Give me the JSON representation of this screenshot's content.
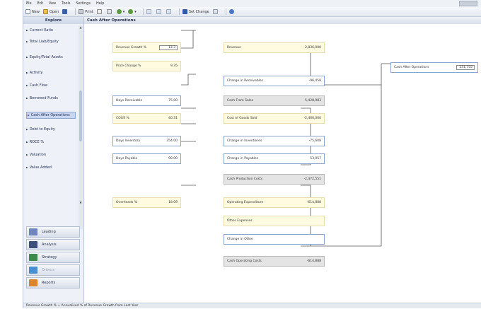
{
  "menu": [
    "Ele",
    "Edt",
    "Vew",
    "Tools",
    "Settings",
    "Help"
  ],
  "toolbar": {
    "new_label": "New",
    "open_label": "Open",
    "print_label": "Print",
    "set_change_label": "Set Change"
  },
  "sidebar": {
    "title": "Explore",
    "items": [
      "Current Ratio",
      "Total Liab/Equity",
      "Equity/Total Assets",
      "Activity",
      "Cash Flow",
      "Borrowed Funds",
      "Cash After Operations",
      "Debt to Equity",
      "ROCE %",
      "Valuation",
      "Value Added"
    ],
    "selected_index": 6,
    "nav_buttons": [
      "Leading",
      "Analysis",
      "Strategy",
      "Drivers",
      "Reports"
    ]
  },
  "panel": {
    "title": "Cash After Operations",
    "inputs": [
      {
        "label": "Revenue Growth %",
        "value": "13.3"
      },
      {
        "label": "Price Change %",
        "value": "9.35"
      },
      {
        "label": "Days Receivable",
        "value": "75.00"
      },
      {
        "label": "COGS %",
        "value": "40.31"
      },
      {
        "label": "Days Inventory",
        "value": "354.00"
      },
      {
        "label": "Days Payable",
        "value": "90.00"
      },
      {
        "label": "Overheads %",
        "value": "18.09"
      }
    ],
    "computed": [
      {
        "label": "Revenue",
        "value": "2,836,000"
      },
      {
        "label": "Change in Receivables",
        "value": "-96,458"
      },
      {
        "label": "Cash From Sales",
        "value": "5,428,983"
      },
      {
        "label": "Cost of Goods Sold",
        "value": "-2,460,000"
      },
      {
        "label": "Change in Inventories",
        "value": "-75,608"
      },
      {
        "label": "Change in Payables",
        "value": "53,057"
      },
      {
        "label": "Cash Production Costs",
        "value": "-2,472,551"
      },
      {
        "label": "Operating Expenditure",
        "value": "-614,888"
      },
      {
        "label": "Other Expenses",
        "value": ""
      },
      {
        "label": "Change in Other",
        "value": ""
      },
      {
        "label": "Cash Operating Costs",
        "value": "-614,888"
      }
    ],
    "result": {
      "label": "Cash After Operations",
      "value": "231,755"
    }
  },
  "status": "Revenue Growth % = Annualised % of Revenue Growth from Last Year",
  "colors": {
    "input_bg": "#fffbe0",
    "computed_border": "#8ea3c9",
    "total_bg": "#e4e4e4",
    "selected_item": "#c8d6ef"
  }
}
